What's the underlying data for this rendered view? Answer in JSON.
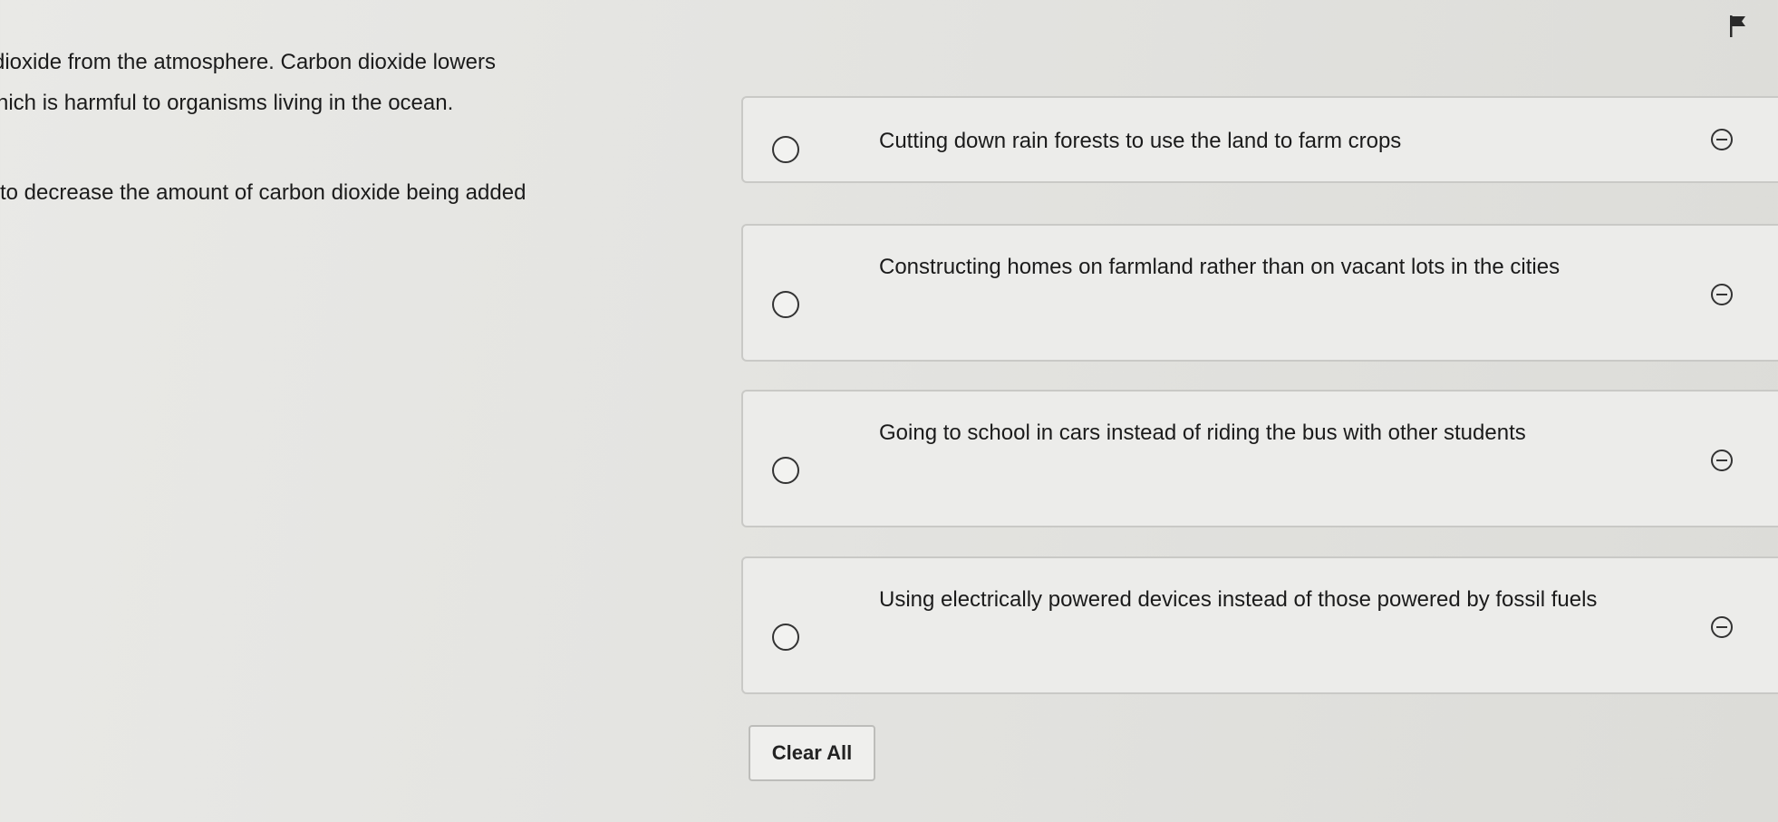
{
  "passage": {
    "line1": "dioxide from the atmosphere.  Carbon dioxide lowers",
    "line2": "hich is harmful to organisms living in the ocean.",
    "line3": "to decrease the amount of carbon dioxide being added"
  },
  "options": [
    {
      "text": "Cutting down rain forests to use the land to farm crops"
    },
    {
      "text": "Constructing homes on farmland rather than on vacant lots in the cities"
    },
    {
      "text": "Going to school in cars instead of riding the bus with other students"
    },
    {
      "text": "Using electrically powered devices instead of those powered by fossil fuels"
    }
  ],
  "actions": {
    "clear_all_label": "Clear All"
  },
  "icons": {
    "flag": "flag-icon",
    "radio": "radio-button-icon",
    "strikethrough": "minus-circle-icon"
  }
}
